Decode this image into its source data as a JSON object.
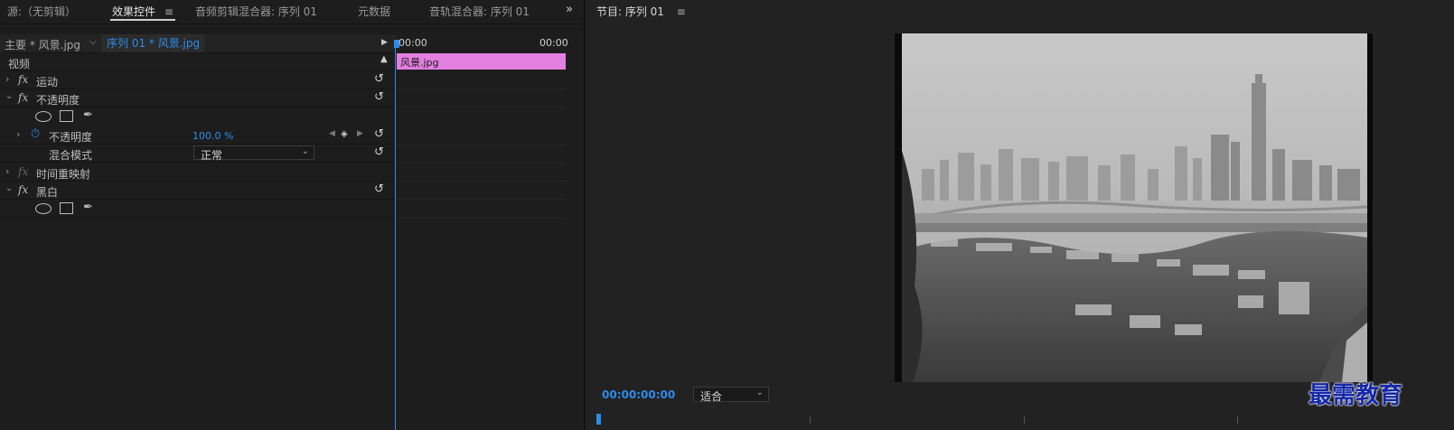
{
  "left_tabs": {
    "source": "源:（无剪辑）",
    "effect_controls": "效果控件",
    "audio_clip_mixer": "音频剪辑混合器: 序列 01",
    "metadata": "元数据",
    "audio_track_mixer": "音轨混合器: 序列 01",
    "menu_glyph": "≡",
    "overflow_glyph": "»"
  },
  "effect_controls": {
    "master_label": "主要 * 风景.jpg",
    "sequence_label": "序列 01 * 风景.jpg",
    "section_video": "视频",
    "fx_glyph": "fx",
    "motion": "运动",
    "opacity_group": "不透明度",
    "opacity_param": "不透明度",
    "opacity_value": "100.0 %",
    "blend_mode_label": "混合模式",
    "blend_mode_value": "正常",
    "time_remap": "时间重映射",
    "black_white": "黑白"
  },
  "timeline": {
    "time_start": "00:00",
    "time_end": "00:00",
    "clip_name": "风景.jpg"
  },
  "program": {
    "title": "节目: 序列 01",
    "menu_glyph": "≡",
    "timecode": "00:00:00:00",
    "fit_value": "适合"
  },
  "watermark": "最需教育",
  "colors": {
    "accent_blue": "#2d8ceb",
    "clip_pink": "#e27fdf",
    "panel_bg": "#1d1d1d"
  }
}
